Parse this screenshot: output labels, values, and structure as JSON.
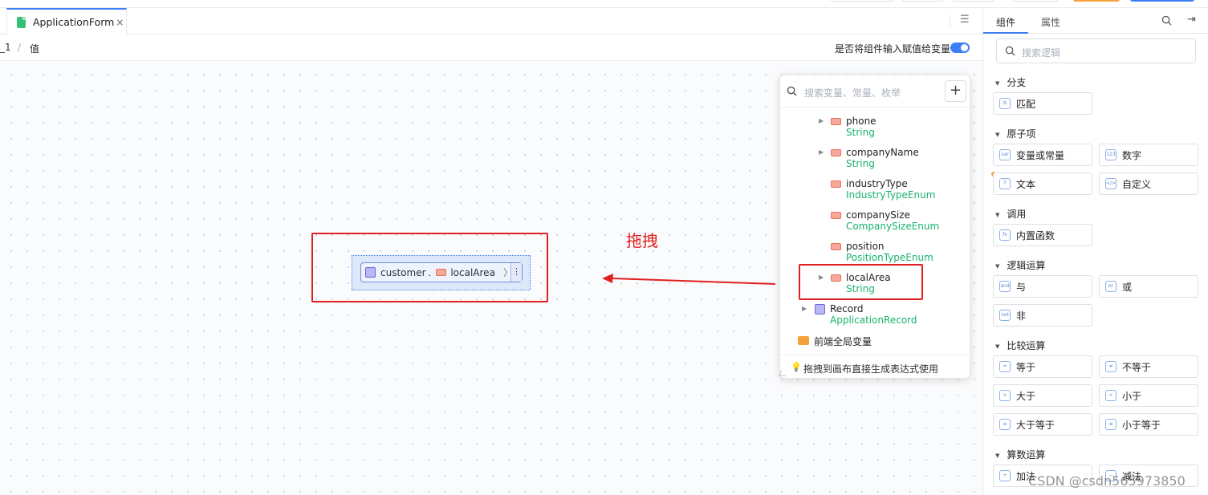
{
  "tab": {
    "title": "ApplicationForm",
    "close": "×"
  },
  "breadcrumb": {
    "first": "_1",
    "separator": "/",
    "second": "值"
  },
  "assign_toggle": {
    "label": "是否将组件输入赋值给变量",
    "on": true
  },
  "canvas": {
    "expression": {
      "object": "customer",
      "dot": ".",
      "property": "localArea",
      "chevron": "〉",
      "more": "⋮"
    },
    "drag_label": "拖拽"
  },
  "picker": {
    "search_placeholder": "搜索变量、常量、枚举",
    "add": "+",
    "items": [
      {
        "name": "phone",
        "type": "String"
      },
      {
        "name": "companyName",
        "type": "String"
      },
      {
        "name": "industryType",
        "type": "IndustryTypeEnum"
      },
      {
        "name": "companySize",
        "type": "CompanySizeEnum"
      },
      {
        "name": "position",
        "type": "PositionTypeEnum"
      },
      {
        "name": "localArea",
        "type": "String"
      },
      {
        "name": "Record",
        "type": "ApplicationRecord"
      }
    ],
    "folder": "前端全局变量",
    "footer": "拖拽到画布直接生成表达式使用"
  },
  "right_panel": {
    "tabs": [
      "组件",
      "属性"
    ],
    "search_placeholder": "搜索逻辑",
    "sections": [
      {
        "title": "分支",
        "items": [
          "匹配"
        ]
      },
      {
        "title": "原子项",
        "items": [
          "变量或常量",
          "数字",
          "文本",
          "自定义"
        ]
      },
      {
        "title": "调用",
        "items": [
          "内置函数"
        ]
      },
      {
        "title": "逻辑运算",
        "items": [
          "与",
          "或",
          "非"
        ]
      },
      {
        "title": "比较运算",
        "items": [
          "等于",
          "不等于",
          "大于",
          "小于",
          "大于等于",
          "小于等于"
        ]
      },
      {
        "title": "算数运算",
        "items": [
          "加法",
          "减法"
        ]
      }
    ],
    "icons": [
      "⚖",
      "var",
      "123",
      "T",
      "</>",
      "fx",
      "and",
      "or",
      "not",
      "=",
      "≠",
      ">",
      "<",
      "≥",
      "≤",
      "+",
      "−"
    ]
  },
  "watermark": "CSDN @csdn565973850",
  "colors": {
    "accent": "#3d7ef5",
    "annotation": "#e02020",
    "type_text": "#18b26e"
  }
}
